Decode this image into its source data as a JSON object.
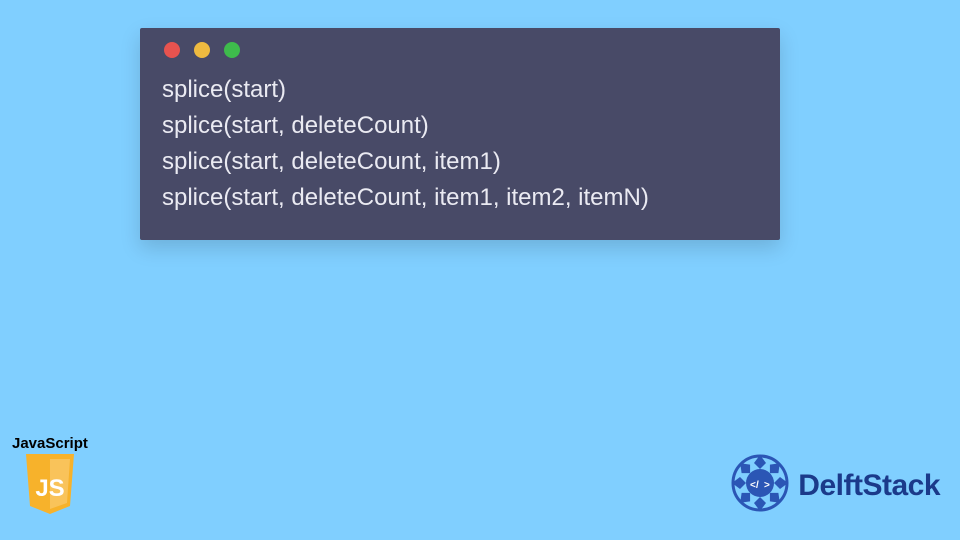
{
  "code": {
    "lines": [
      "splice(start)",
      "splice(start, deleteCount)",
      "splice(start, deleteCount, item1)",
      "splice(start, deleteCount, item1, item2, itemN)"
    ]
  },
  "js_badge": {
    "label": "JavaScript",
    "logo_text": "JS"
  },
  "brand": {
    "name": "DelftStack"
  },
  "colors": {
    "background": "#80cfff",
    "window_bg": "#484a67",
    "code_text": "#eaeaf2",
    "dot_red": "#e7534f",
    "dot_yellow": "#eeba40",
    "dot_green": "#3ebb4c",
    "js_yellow": "#f7b22b",
    "brand_blue": "#1b3a8a"
  }
}
